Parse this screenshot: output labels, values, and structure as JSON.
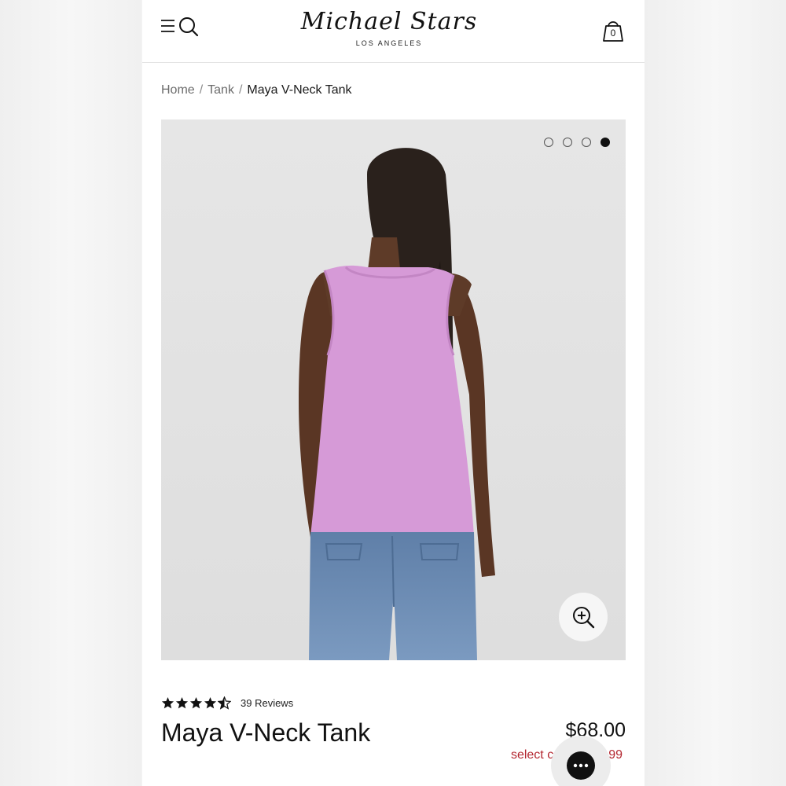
{
  "brand": {
    "name": "Michael Stars",
    "tagline": "LOS ANGELES"
  },
  "header": {
    "cart_count": "0"
  },
  "breadcrumb": {
    "items": [
      {
        "label": "Home"
      },
      {
        "label": "Tank"
      },
      {
        "label": "Maya V-Neck Tank"
      }
    ],
    "separator": "/"
  },
  "gallery": {
    "image_count": 4,
    "active_index": 3,
    "image_description_icon": "product-photo",
    "garment_color": "#d69ad7"
  },
  "product": {
    "title": "Maya V-Neck Tank",
    "price": "$68.00",
    "rating": 4.5,
    "rating_max": 5,
    "reviews": "39 Reviews",
    "promo_text": "select c",
    "promo_tail": "99"
  },
  "colors": {
    "accent_red": "#b3262f",
    "text": "#111111"
  },
  "icons": {
    "menu": "menu-icon",
    "search": "search-icon",
    "cart": "shopping-bag-icon",
    "zoom": "zoom-in-icon",
    "chat": "chat-icon"
  }
}
